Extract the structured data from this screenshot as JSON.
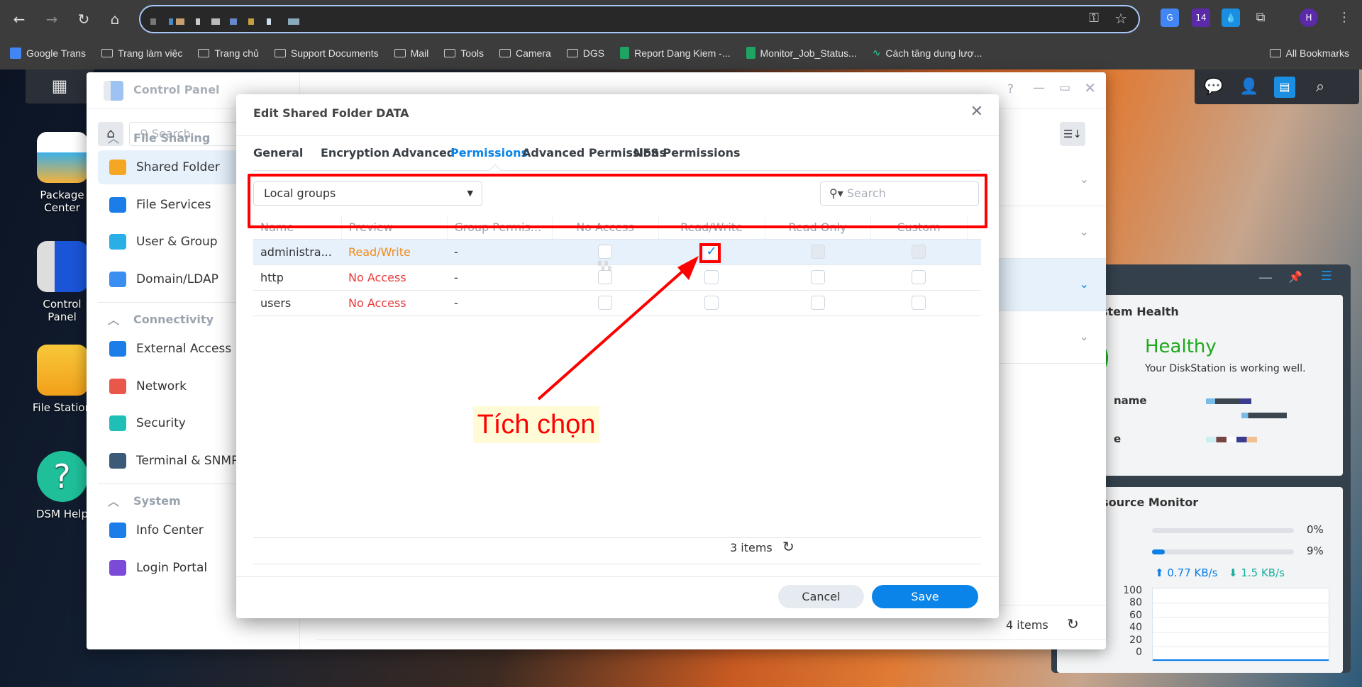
{
  "browser": {
    "bookmarks": [
      {
        "label": "Google Trans",
        "icon": "google-translate-icon"
      },
      {
        "label": "Trang làm việc",
        "icon": "folder-icon"
      },
      {
        "label": "Trang chủ",
        "icon": "folder-icon"
      },
      {
        "label": "Support Documents",
        "icon": "folder-icon"
      },
      {
        "label": "Mail",
        "icon": "folder-icon"
      },
      {
        "label": "Tools",
        "icon": "folder-icon"
      },
      {
        "label": "Camera",
        "icon": "folder-icon"
      },
      {
        "label": "DGS",
        "icon": "folder-icon"
      },
      {
        "label": "Report Dang Kiem -...",
        "icon": "sheets-icon"
      },
      {
        "label": "Monitor_Job_Status...",
        "icon": "sheets-icon"
      },
      {
        "label": "Cách tăng dung lượ...",
        "icon": "chart-icon"
      }
    ],
    "all_bookmarks": "All Bookmarks",
    "ext_badge": "14",
    "profile": "H"
  },
  "desktop": {
    "icons": [
      {
        "label": "Package Center"
      },
      {
        "label": "Control Panel"
      },
      {
        "label": "File Station"
      },
      {
        "label": "DSM Help"
      }
    ]
  },
  "control_panel": {
    "title": "Control Panel",
    "search_placeholder": "Search",
    "sections": [
      {
        "title": "File Sharing",
        "items": [
          "Shared Folder",
          "File Services",
          "User & Group",
          "Domain/LDAP"
        ]
      },
      {
        "title": "Connectivity",
        "items": [
          "External Access",
          "Network",
          "Security",
          "Terminal & SNMP"
        ]
      },
      {
        "title": "System",
        "items": [
          "Info Center",
          "Login Portal"
        ]
      }
    ],
    "footer_count": "4 items"
  },
  "dialog": {
    "title": "Edit Shared Folder DATA",
    "tabs": [
      "General",
      "Encryption",
      "Advanced",
      "Permissions",
      "Advanced Permissions",
      "NFS Permissions"
    ],
    "active_tab": "Permissions",
    "group_select": "Local groups",
    "search_placeholder": "Search",
    "columns": [
      "Name",
      "Preview",
      "Group Permis...",
      "No Access",
      "Read/Write",
      "Read Only",
      "Custom"
    ],
    "rows": [
      {
        "name": "administra...",
        "preview": "Read/Write",
        "group": "-",
        "no_access": false,
        "read_write": true,
        "read_only": false,
        "custom": false
      },
      {
        "name": "http",
        "preview": "No Access",
        "group": "-",
        "no_access": false,
        "read_write": false,
        "read_only": false,
        "custom": false
      },
      {
        "name": "users",
        "preview": "No Access",
        "group": "-",
        "no_access": false,
        "read_write": false,
        "read_only": false,
        "custom": false
      }
    ],
    "item_count": "3 items",
    "cancel": "Cancel",
    "save": "Save"
  },
  "annotation": {
    "text": "Tích chọn",
    "color": "#ff0000"
  },
  "widgets": {
    "health_title": "System Health",
    "status": "Healthy",
    "status_desc": "Your DiskStation is working well.",
    "server_name_label": "name",
    "row3_label": "e",
    "resource_title": "Resource Monitor",
    "cpu": "0%",
    "cpu_value": 0,
    "ram": "9%",
    "ram_value": 9,
    "upload": "0.77 KB/s",
    "download": "1.5 KB/s",
    "y_ticks": [
      "100",
      "80",
      "60",
      "40",
      "20",
      "0"
    ]
  }
}
